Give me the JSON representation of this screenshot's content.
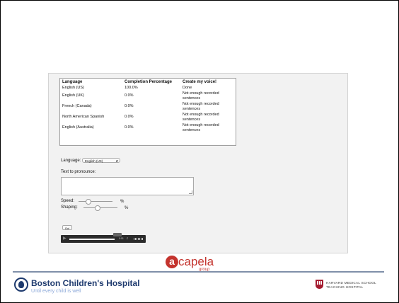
{
  "table": {
    "headers": [
      "Language",
      "Completion Percentage",
      "Create my voice!"
    ],
    "rows": [
      {
        "language": "English (US)",
        "percent": "100.0%",
        "status": "Done"
      },
      {
        "language": "English (UK)",
        "percent": "0.0%",
        "status": "Not enough recorded sentences"
      },
      {
        "language": "French (Canada)",
        "percent": "0.0%",
        "status": "Not enough recorded sentences"
      },
      {
        "language": "North American Spanish",
        "percent": "0.0%",
        "status": "Not enough recorded sentences"
      },
      {
        "language": "English (Australia)",
        "percent": "0.0%",
        "status": "Not enough recorded sentences"
      }
    ]
  },
  "form": {
    "language_label": "Language:",
    "language_value": "English (US)",
    "text_label": "Text to pronounce:",
    "text_value": "",
    "speed_label": "Speed:",
    "speed_unit": "%",
    "shaping_label": "Shaping:",
    "shaping_unit": "%",
    "go_label": "Go!"
  },
  "player": {
    "time": "0:01"
  },
  "footer": {
    "acapela_word": "capela",
    "acapela_letter": "a",
    "acapela_group": "group",
    "hospital_name": "Boston Children's Hospital",
    "hospital_tagline": "Until every child is well",
    "harvard_line1": "HARVARD MEDICAL SCHOOL",
    "harvard_line2": "TEACHING HOSPITAL"
  },
  "colors": {
    "acapela_red": "#c4342e",
    "bch_blue": "#1e3a6e",
    "harvard_crimson": "#a51c30"
  },
  "icons": {
    "play": "play-icon",
    "volume": "volume-icon",
    "select_arrow": "chevron-updown-icon"
  }
}
